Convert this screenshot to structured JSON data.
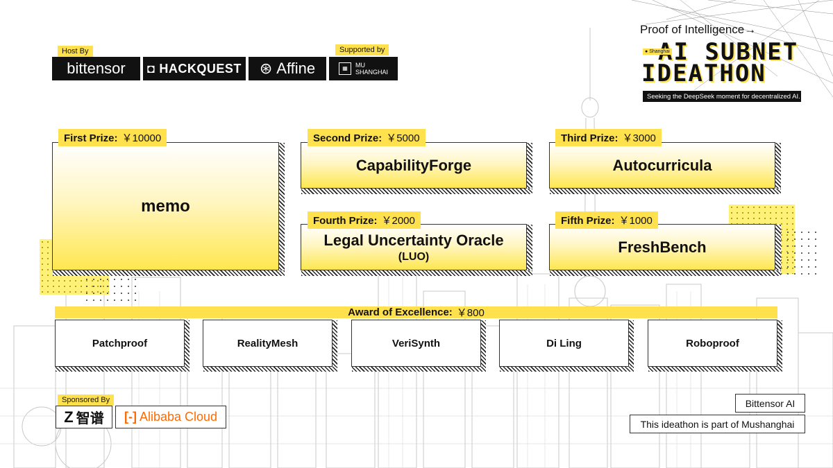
{
  "header": {
    "host_label": "Host By",
    "supported_label": "Supported by",
    "hosts": [
      {
        "name": "bittensor"
      },
      {
        "name": "HACKQUEST"
      },
      {
        "name": "Affine"
      }
    ],
    "supporter": {
      "line1": "MU",
      "line2": "SHANGHAI"
    }
  },
  "title": {
    "proof": "Proof of Intelligence→",
    "location": "Shanghai",
    "line1": "AI SUBNET",
    "line2": "IDEATHON",
    "tagline": "Seeking the DeepSeek moment for decentralized AI."
  },
  "prizes": [
    {
      "label": "First Prize:",
      "amount": "￥10000",
      "winner": "memo",
      "sub": ""
    },
    {
      "label": "Second Prize:",
      "amount": "￥5000",
      "winner": "CapabilityForge",
      "sub": ""
    },
    {
      "label": "Third Prize:",
      "amount": "￥3000",
      "winner": "Autocurricula",
      "sub": ""
    },
    {
      "label": "Fourth Prize:",
      "amount": "￥2000",
      "winner": "Legal Uncertainty Oracle",
      "sub": "(LUO)"
    },
    {
      "label": "Fifth Prize:",
      "amount": "￥1000",
      "winner": "FreshBench",
      "sub": ""
    }
  ],
  "excellence": {
    "label": "Award of Excellence:",
    "amount": "￥800",
    "winners": [
      "Patchproof",
      "RealityMesh",
      "VeriSynth",
      "Di Ling",
      "Roboproof"
    ]
  },
  "sponsors": {
    "label": "Sponsored By",
    "zhipu": {
      "mark": "Z",
      "name": "智谱"
    },
    "alibaba": {
      "mark": "[-]",
      "name": "Alibaba Cloud"
    }
  },
  "footer": {
    "account": "Bittensor AI",
    "note": "This ideathon is part of Mushanghai"
  },
  "colors": {
    "accent": "#ffe14d",
    "dark": "#111111"
  }
}
